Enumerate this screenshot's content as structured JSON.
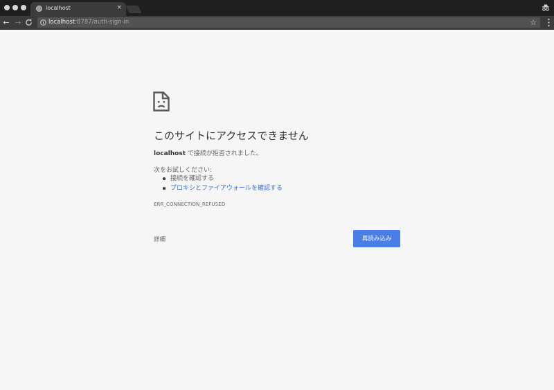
{
  "browser": {
    "tab": {
      "title": "localhost",
      "close_glyph": "×",
      "favicon": "globe-icon"
    },
    "toolbar": {
      "back_glyph": "←",
      "forward_glyph": "→",
      "reload_glyph": "C",
      "url_host": "localhost",
      "url_rest": ":8787/auth-sign-in",
      "bookmark_glyph": "☆"
    }
  },
  "error_page": {
    "icon": "sad-page-icon",
    "heading": "このサイトにアクセスできません",
    "host": "localhost",
    "description": " で接続が拒否されました。",
    "suggestions_title": "次をお試しください:",
    "suggestions": [
      "接続を確認する",
      "プロキシとファイアウォールを確認する"
    ],
    "error_code": "ERR_CONNECTION_REFUSED",
    "details_label": "詳細",
    "reload_label": "再読み込み"
  },
  "colors": {
    "tab_strip": "#1f1f1f",
    "toolbar": "#3b3b3b",
    "page_background": "#f6f6f6",
    "link": "#3a6ed0",
    "primary_button": "#4a7fe8"
  }
}
